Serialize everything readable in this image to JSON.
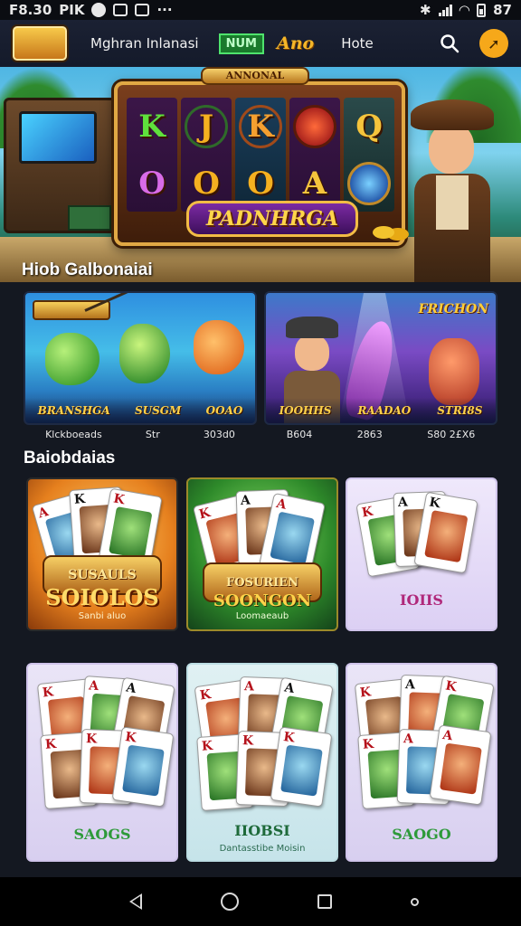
{
  "status_bar": {
    "time": "F8.30",
    "left_text": "PIK",
    "right_text": "87"
  },
  "top_nav": {
    "logo_text": "",
    "link_1": "Mghran Inlanasi",
    "badge_green": "NUM",
    "badge_gold": "Ano",
    "home": "Hote",
    "colors": {
      "accent": "#f6a81a",
      "badge": "#1a7a2c"
    }
  },
  "hero": {
    "top_label": "ANNONAL",
    "slot_title": "PADNHRGA",
    "reels": [
      [
        "K",
        "O"
      ],
      [
        "J",
        "O"
      ],
      [
        "K",
        "O"
      ],
      [
        "",
        "A"
      ],
      [
        "Q",
        ""
      ]
    ],
    "machine_panel": "",
    "section_title": "Hiob Galbonaiai"
  },
  "featured": [
    {
      "caption_left": "BRANSHGA",
      "caption_mid": "SUSGM",
      "caption_right": "OOAO",
      "stats": [
        "Klckboeads",
        "Str",
        "303d0"
      ]
    },
    {
      "title": "FRICHON",
      "subtitle": "",
      "caption_left": "IOOHHS",
      "caption_mid": "RAADAO",
      "caption_right": "STRI8S",
      "stats": [
        "B604",
        "2863",
        "S80 2£X6"
      ]
    }
  ],
  "section2_title": "Baiobdaias",
  "games_row1": [
    {
      "title": "SOIOLOS",
      "ribbon": "SUSAULS",
      "sub": "Sanbi aluo"
    },
    {
      "title": "SOONGON",
      "ribbon": "FOSURIEN",
      "sub": "Loomaeaub"
    },
    {
      "title": "IOIIS",
      "sub": ""
    }
  ],
  "games_row2": [
    {
      "title": "SAOGS",
      "sub": ""
    },
    {
      "title": "IIOBSI",
      "sub": "Dantasstibe Moisin"
    },
    {
      "title": "SAOGO",
      "sub": ""
    }
  ],
  "icons": {
    "search": "search-icon",
    "avatar": "lightning-icon",
    "back": "back-triangle-icon",
    "home": "home-circle-icon",
    "recent": "recents-square-icon",
    "assistant": "assistant-dot-icon"
  }
}
